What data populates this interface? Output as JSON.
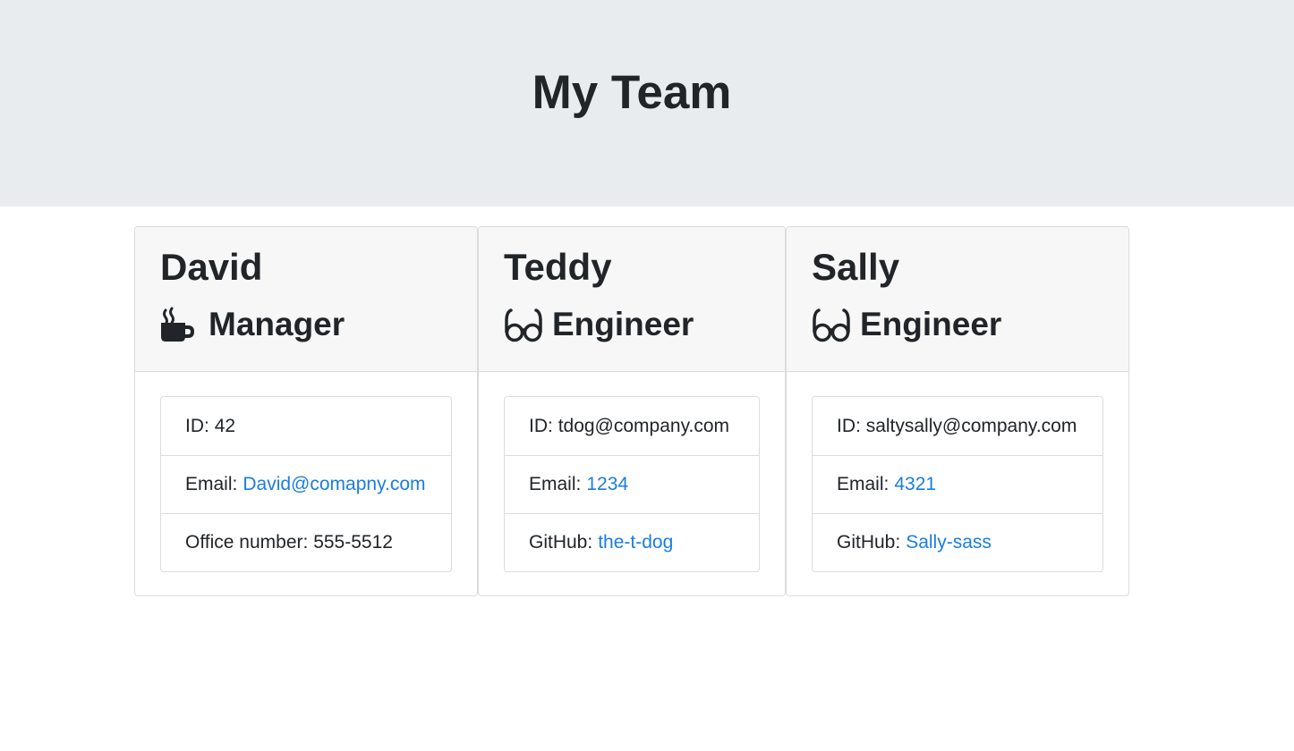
{
  "header": {
    "title": "My Team"
  },
  "team": [
    {
      "name": "David",
      "role": "Manager",
      "icon": "coffee-mug-icon",
      "id_label": "ID:",
      "id_value": "42",
      "email_label": "Email:",
      "email_value": "David@comapny.com",
      "extra_label": "Office number:",
      "extra_value": "555-5512"
    },
    {
      "name": "Teddy",
      "role": "Engineer",
      "icon": "glasses-icon",
      "id_label": "ID:",
      "id_value": "tdog@company.com",
      "email_label": "Email:",
      "email_value": "1234",
      "extra_label": "GitHub:",
      "extra_value": "the-t-dog"
    },
    {
      "name": "Sally",
      "role": "Engineer",
      "icon": "glasses-icon",
      "id_label": "ID:",
      "id_value": "saltysally@company.com",
      "email_label": "Email:",
      "email_value": "4321",
      "extra_label": "GitHub:",
      "extra_value": "Sally-sass"
    }
  ],
  "colors": {
    "header_background": "#e9ecef",
    "link": "#1a7de0",
    "text": "#212529",
    "card_header_background": "#f7f7f7"
  }
}
